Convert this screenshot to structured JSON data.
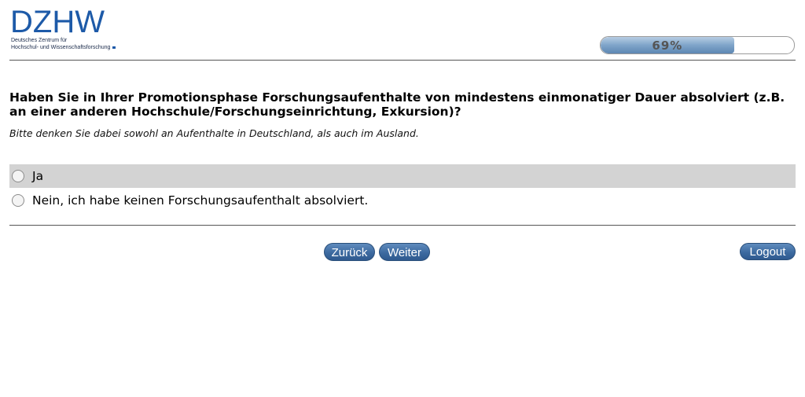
{
  "header": {
    "logo": {
      "wordmark": "DZHW",
      "line1": "Deutsches Zentrum für",
      "line2": "Hochschul- und Wissenschaftsforschung"
    },
    "progress": {
      "percent": 69,
      "label": "69%"
    }
  },
  "question": {
    "text": "Haben Sie in Ihrer Promotionsphase Forschungsaufenthalte von mindestens einmonatiger Dauer absolviert (z.B. an einer anderen Hochschule/Forschungseinrichtung, Exkursion)?",
    "hint": "Bitte denken Sie dabei sowohl an Aufenthalte in Deutschland, als auch im Ausland."
  },
  "options": [
    {
      "label": "Ja",
      "selected": false
    },
    {
      "label": "Nein, ich habe keinen Forschungsaufenthalt absolviert.",
      "selected": false
    }
  ],
  "nav": {
    "back_label": "Zurück",
    "next_label": "Weiter",
    "logout_label": "Logout"
  },
  "colors": {
    "brand": "#1d5aa8",
    "button": "#3d6aa0",
    "highlight_row": "#d3d3d3"
  }
}
